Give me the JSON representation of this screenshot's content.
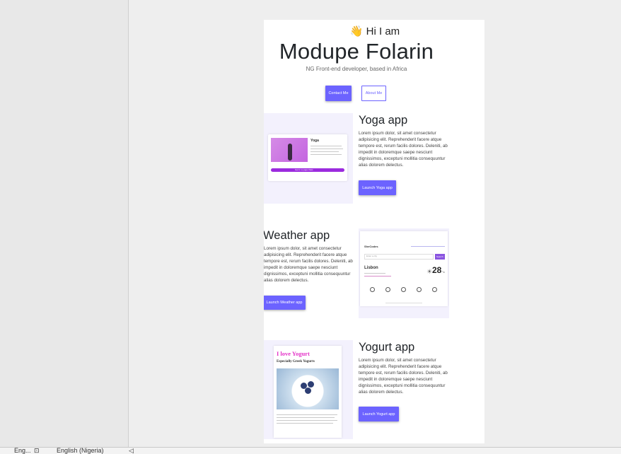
{
  "statusbar": {
    "items": [
      "Eng...",
      "English (Nigeria)"
    ]
  },
  "hero": {
    "wave": "👋",
    "greeting": "Hi I am",
    "name": "Modupe Folarin",
    "role": "NG Front-end developer, based in Africa",
    "contact_label": "Contact Me",
    "about_label": "About Me"
  },
  "projects": [
    {
      "title": "Yoga app",
      "desc": "Lorem ipsum dolor, sit amet consectetur adipisicing elit. Reprehenderit facere atque tempore est, rerum facilis dolores. Deleniti, ab impedit in doloremque saepe nesciunt dignissimos, exceptuni mollitia consequuntur alias dolorem delectus.",
      "button": "Launch Yoga app",
      "mock": {
        "title": "Yoga",
        "button": "Get in a yoga class"
      }
    },
    {
      "title": "Weather app",
      "desc": "Lorem ipsum dolor, sit amet consectetur adipisicing elit. Reprehenderit facere atque tempore est, rerum facilis dolores. Deleniti, ab impedit in doloremque saepe nesciunt dignissimos, exceptuni mollitia consequuntur alias dolorem delectus.",
      "button": "Launch Weather app",
      "mock": {
        "brand": "SheCodes",
        "city": "Lisbon",
        "temp": "28",
        "unit": "°c",
        "search": "Enter a city",
        "go": "Search"
      }
    },
    {
      "title": "Yogurt app",
      "desc": "Lorem ipsum dolor, sit amet consectetur adipisicing elit. Reprehenderit facere atque tempore est, rerum facilis dolores. Deleniti, ab impedit in doloremque saepe nesciunt dignissimos, exceptuni mollitia consequuntur alias dolorem delectus.",
      "button": "Launch Yogurt app",
      "mock": {
        "heading": "I love Yogurt",
        "sub": "Especially Greek Yogurts"
      }
    }
  ]
}
